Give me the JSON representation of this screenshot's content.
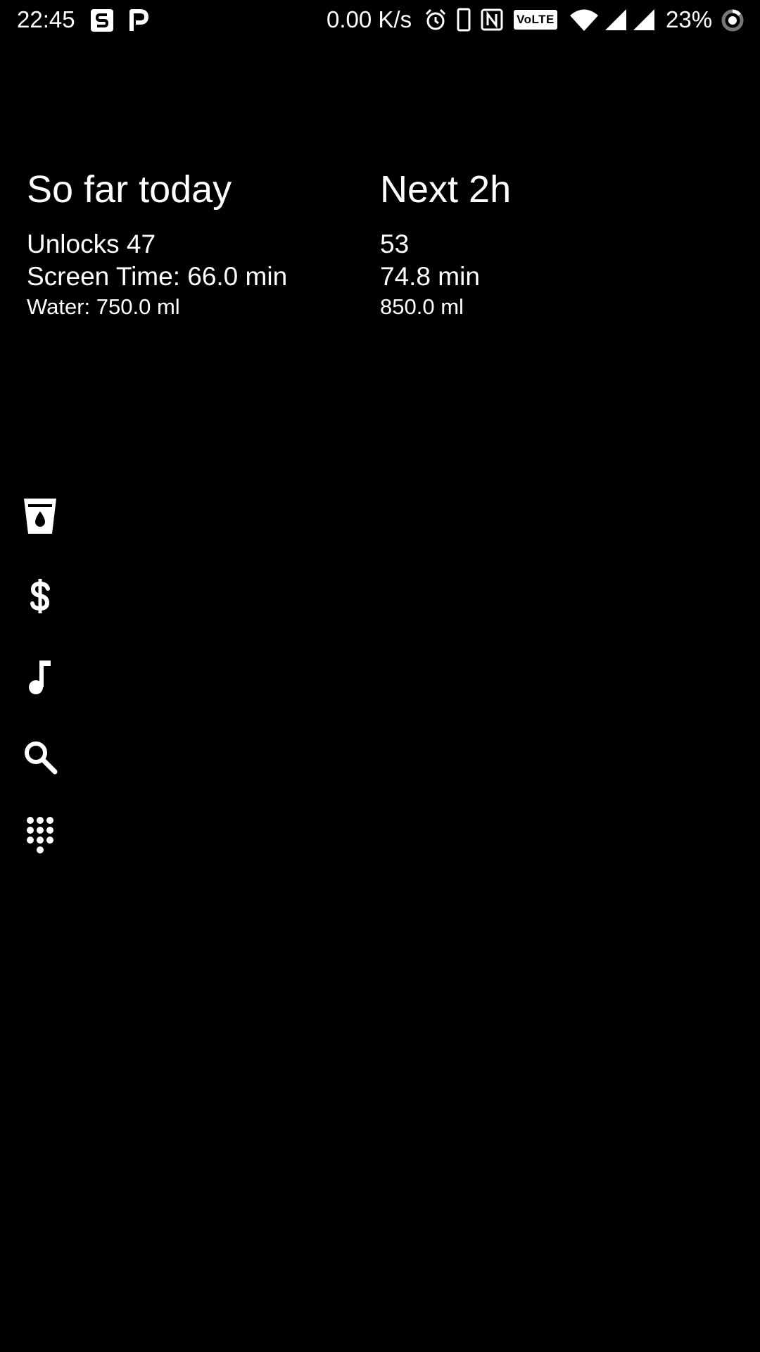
{
  "status_bar": {
    "time": "22:45",
    "network_speed": "0.00 K/s",
    "volte_label": "VoLTE",
    "battery_percent": "23%",
    "notification_icons": [
      "s-app-icon",
      "p-app-icon"
    ],
    "system_icons": [
      "alarm-icon",
      "phone-icon",
      "nfc-icon",
      "volte-icon",
      "wifi-icon",
      "signal-icon",
      "signal-icon-2",
      "battery-ring-icon"
    ]
  },
  "stats": {
    "today": {
      "heading": "So far today",
      "unlocks": "Unlocks 47",
      "screen_time": "Screen Time: 66.0 min",
      "water": "Water: 750.0 ml"
    },
    "next": {
      "heading": "Next 2h",
      "unlocks": "53",
      "screen_time": "74.8 min",
      "water": "850.0 ml"
    }
  },
  "actions": [
    {
      "icon": "water-cup-icon"
    },
    {
      "icon": "dollar-icon"
    },
    {
      "icon": "music-note-icon"
    },
    {
      "icon": "search-icon"
    },
    {
      "icon": "dialpad-icon"
    }
  ],
  "colors": {
    "background": "#000000",
    "foreground": "#ffffff"
  }
}
